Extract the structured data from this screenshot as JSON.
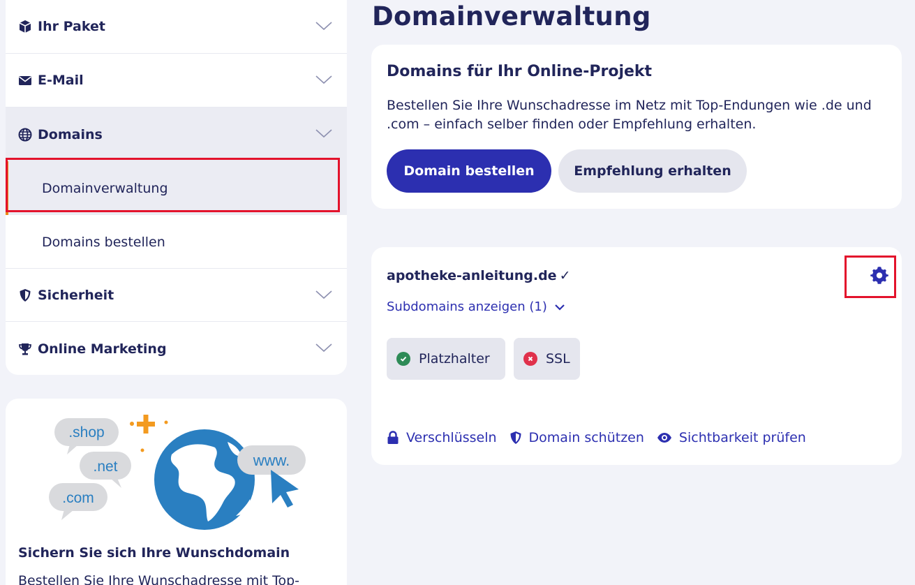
{
  "sidebar": {
    "items": [
      {
        "label": "Ihr Paket",
        "icon": "package-icon"
      },
      {
        "label": "E-Mail",
        "icon": "envelope-icon"
      },
      {
        "label": "Domains",
        "icon": "globe-icon"
      },
      {
        "label": "Sicherheit",
        "icon": "shield-icon"
      },
      {
        "label": "Online Marketing",
        "icon": "trophy-icon"
      }
    ],
    "sub_items": [
      {
        "label": "Domainverwaltung"
      },
      {
        "label": "Domains bestellen"
      }
    ]
  },
  "promo": {
    "bubbles": [
      ".shop",
      ".net",
      ".com",
      "www."
    ],
    "title": "Sichern Sie sich Ihre Wunschdomain",
    "text": "Bestellen Sie Ihre Wunschadresse mit Top-"
  },
  "main": {
    "title": "Domainverwaltung",
    "order_card": {
      "heading": "Domains für Ihr Online-Projekt",
      "text": "Bestellen Sie Ihre Wunschadresse im Netz mit Top-Endungen wie .de und .com – einfach selber finden oder Empfehlung erhalten.",
      "primary_button": "Domain bestellen",
      "secondary_button": "Empfehlung erhalten"
    },
    "domain_card": {
      "domain": "apotheke-anleitung.de",
      "verified_mark": "✓",
      "subdomains_link": "Subdomains anzeigen (1)",
      "tags": [
        {
          "label": "Platzhalter",
          "status": "ok"
        },
        {
          "label": "SSL",
          "status": "error"
        }
      ],
      "links": [
        {
          "label": "Verschlüsseln",
          "icon": "lock-icon"
        },
        {
          "label": "Domain schützen",
          "icon": "shield-icon"
        },
        {
          "label": "Sichtbarkeit prüfen",
          "icon": "eye-icon"
        }
      ]
    }
  },
  "colors": {
    "accent": "#2c2fb0",
    "text": "#21255a",
    "highlight": "#e3132c",
    "status_ok": "#2e8b57",
    "status_error": "#e0314b",
    "promo_orange": "#f39a1f",
    "globe_blue": "#2a7fc1"
  }
}
